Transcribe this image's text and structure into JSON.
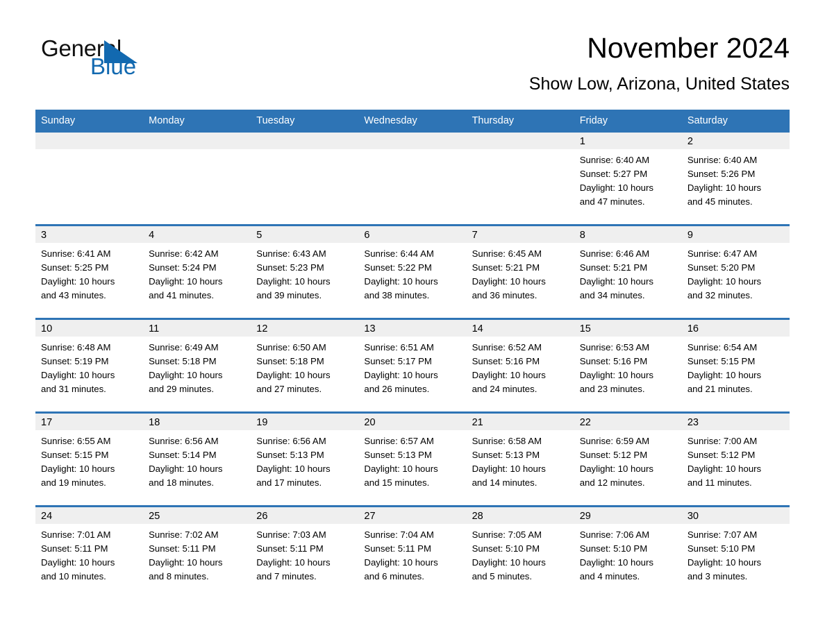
{
  "brand": {
    "name_part1": "General",
    "name_part2": "Blue",
    "triangle_icon": "triangle-icon",
    "accent_color": "#1269b0"
  },
  "header": {
    "month_title": "November 2024",
    "location": "Show Low, Arizona, United States"
  },
  "theme": {
    "header_blue": "#2e74b5",
    "daynum_band": "#efefef",
    "cell_background": "#ffffff"
  },
  "calendar": {
    "weekday_headers": [
      "Sunday",
      "Monday",
      "Tuesday",
      "Wednesday",
      "Thursday",
      "Friday",
      "Saturday"
    ],
    "weeks": [
      [
        {
          "day": "",
          "empty": true
        },
        {
          "day": "",
          "empty": true
        },
        {
          "day": "",
          "empty": true
        },
        {
          "day": "",
          "empty": true
        },
        {
          "day": "",
          "empty": true
        },
        {
          "day": "1",
          "sunrise": "Sunrise: 6:40 AM",
          "sunset": "Sunset: 5:27 PM",
          "daylight_line1": "Daylight: 10 hours",
          "daylight_line2": "and 47 minutes."
        },
        {
          "day": "2",
          "sunrise": "Sunrise: 6:40 AM",
          "sunset": "Sunset: 5:26 PM",
          "daylight_line1": "Daylight: 10 hours",
          "daylight_line2": "and 45 minutes."
        }
      ],
      [
        {
          "day": "3",
          "sunrise": "Sunrise: 6:41 AM",
          "sunset": "Sunset: 5:25 PM",
          "daylight_line1": "Daylight: 10 hours",
          "daylight_line2": "and 43 minutes."
        },
        {
          "day": "4",
          "sunrise": "Sunrise: 6:42 AM",
          "sunset": "Sunset: 5:24 PM",
          "daylight_line1": "Daylight: 10 hours",
          "daylight_line2": "and 41 minutes."
        },
        {
          "day": "5",
          "sunrise": "Sunrise: 6:43 AM",
          "sunset": "Sunset: 5:23 PM",
          "daylight_line1": "Daylight: 10 hours",
          "daylight_line2": "and 39 minutes."
        },
        {
          "day": "6",
          "sunrise": "Sunrise: 6:44 AM",
          "sunset": "Sunset: 5:22 PM",
          "daylight_line1": "Daylight: 10 hours",
          "daylight_line2": "and 38 minutes."
        },
        {
          "day": "7",
          "sunrise": "Sunrise: 6:45 AM",
          "sunset": "Sunset: 5:21 PM",
          "daylight_line1": "Daylight: 10 hours",
          "daylight_line2": "and 36 minutes."
        },
        {
          "day": "8",
          "sunrise": "Sunrise: 6:46 AM",
          "sunset": "Sunset: 5:21 PM",
          "daylight_line1": "Daylight: 10 hours",
          "daylight_line2": "and 34 minutes."
        },
        {
          "day": "9",
          "sunrise": "Sunrise: 6:47 AM",
          "sunset": "Sunset: 5:20 PM",
          "daylight_line1": "Daylight: 10 hours",
          "daylight_line2": "and 32 minutes."
        }
      ],
      [
        {
          "day": "10",
          "sunrise": "Sunrise: 6:48 AM",
          "sunset": "Sunset: 5:19 PM",
          "daylight_line1": "Daylight: 10 hours",
          "daylight_line2": "and 31 minutes."
        },
        {
          "day": "11",
          "sunrise": "Sunrise: 6:49 AM",
          "sunset": "Sunset: 5:18 PM",
          "daylight_line1": "Daylight: 10 hours",
          "daylight_line2": "and 29 minutes."
        },
        {
          "day": "12",
          "sunrise": "Sunrise: 6:50 AM",
          "sunset": "Sunset: 5:18 PM",
          "daylight_line1": "Daylight: 10 hours",
          "daylight_line2": "and 27 minutes."
        },
        {
          "day": "13",
          "sunrise": "Sunrise: 6:51 AM",
          "sunset": "Sunset: 5:17 PM",
          "daylight_line1": "Daylight: 10 hours",
          "daylight_line2": "and 26 minutes."
        },
        {
          "day": "14",
          "sunrise": "Sunrise: 6:52 AM",
          "sunset": "Sunset: 5:16 PM",
          "daylight_line1": "Daylight: 10 hours",
          "daylight_line2": "and 24 minutes."
        },
        {
          "day": "15",
          "sunrise": "Sunrise: 6:53 AM",
          "sunset": "Sunset: 5:16 PM",
          "daylight_line1": "Daylight: 10 hours",
          "daylight_line2": "and 23 minutes."
        },
        {
          "day": "16",
          "sunrise": "Sunrise: 6:54 AM",
          "sunset": "Sunset: 5:15 PM",
          "daylight_line1": "Daylight: 10 hours",
          "daylight_line2": "and 21 minutes."
        }
      ],
      [
        {
          "day": "17",
          "sunrise": "Sunrise: 6:55 AM",
          "sunset": "Sunset: 5:15 PM",
          "daylight_line1": "Daylight: 10 hours",
          "daylight_line2": "and 19 minutes."
        },
        {
          "day": "18",
          "sunrise": "Sunrise: 6:56 AM",
          "sunset": "Sunset: 5:14 PM",
          "daylight_line1": "Daylight: 10 hours",
          "daylight_line2": "and 18 minutes."
        },
        {
          "day": "19",
          "sunrise": "Sunrise: 6:56 AM",
          "sunset": "Sunset: 5:13 PM",
          "daylight_line1": "Daylight: 10 hours",
          "daylight_line2": "and 17 minutes."
        },
        {
          "day": "20",
          "sunrise": "Sunrise: 6:57 AM",
          "sunset": "Sunset: 5:13 PM",
          "daylight_line1": "Daylight: 10 hours",
          "daylight_line2": "and 15 minutes."
        },
        {
          "day": "21",
          "sunrise": "Sunrise: 6:58 AM",
          "sunset": "Sunset: 5:13 PM",
          "daylight_line1": "Daylight: 10 hours",
          "daylight_line2": "and 14 minutes."
        },
        {
          "day": "22",
          "sunrise": "Sunrise: 6:59 AM",
          "sunset": "Sunset: 5:12 PM",
          "daylight_line1": "Daylight: 10 hours",
          "daylight_line2": "and 12 minutes."
        },
        {
          "day": "23",
          "sunrise": "Sunrise: 7:00 AM",
          "sunset": "Sunset: 5:12 PM",
          "daylight_line1": "Daylight: 10 hours",
          "daylight_line2": "and 11 minutes."
        }
      ],
      [
        {
          "day": "24",
          "sunrise": "Sunrise: 7:01 AM",
          "sunset": "Sunset: 5:11 PM",
          "daylight_line1": "Daylight: 10 hours",
          "daylight_line2": "and 10 minutes."
        },
        {
          "day": "25",
          "sunrise": "Sunrise: 7:02 AM",
          "sunset": "Sunset: 5:11 PM",
          "daylight_line1": "Daylight: 10 hours",
          "daylight_line2": "and 8 minutes."
        },
        {
          "day": "26",
          "sunrise": "Sunrise: 7:03 AM",
          "sunset": "Sunset: 5:11 PM",
          "daylight_line1": "Daylight: 10 hours",
          "daylight_line2": "and 7 minutes."
        },
        {
          "day": "27",
          "sunrise": "Sunrise: 7:04 AM",
          "sunset": "Sunset: 5:11 PM",
          "daylight_line1": "Daylight: 10 hours",
          "daylight_line2": "and 6 minutes."
        },
        {
          "day": "28",
          "sunrise": "Sunrise: 7:05 AM",
          "sunset": "Sunset: 5:10 PM",
          "daylight_line1": "Daylight: 10 hours",
          "daylight_line2": "and 5 minutes."
        },
        {
          "day": "29",
          "sunrise": "Sunrise: 7:06 AM",
          "sunset": "Sunset: 5:10 PM",
          "daylight_line1": "Daylight: 10 hours",
          "daylight_line2": "and 4 minutes."
        },
        {
          "day": "30",
          "sunrise": "Sunrise: 7:07 AM",
          "sunset": "Sunset: 5:10 PM",
          "daylight_line1": "Daylight: 10 hours",
          "daylight_line2": "and 3 minutes."
        }
      ]
    ]
  }
}
